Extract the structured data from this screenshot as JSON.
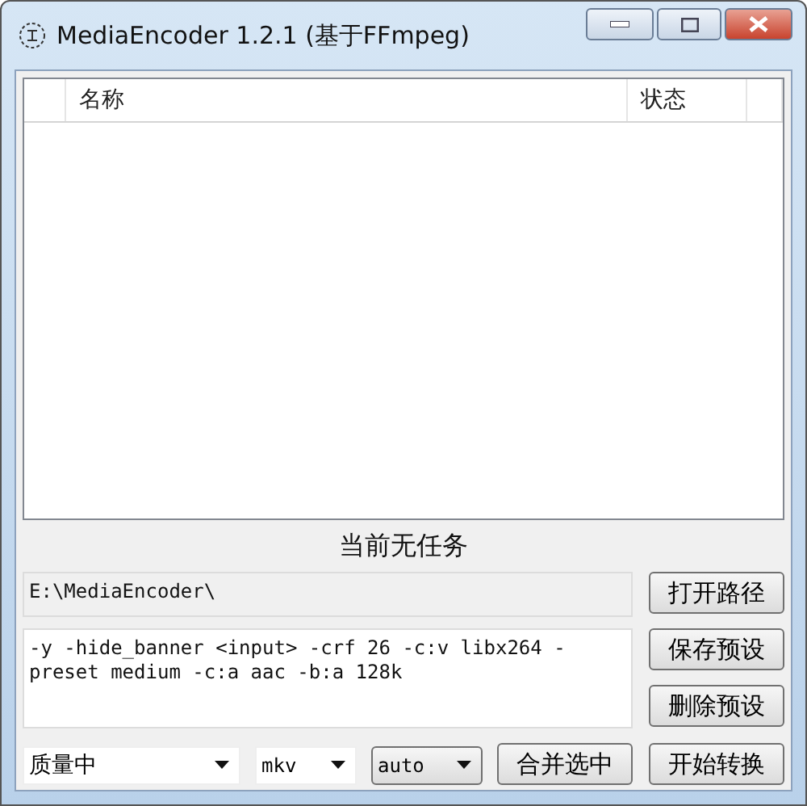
{
  "window": {
    "title": "MediaEncoder 1.2.1 (基于FFmpeg)"
  },
  "task_list": {
    "columns": [
      "名称",
      "状态"
    ]
  },
  "status": "当前无任务",
  "output_path": {
    "value": "E:\\MediaEncoder\\",
    "button": "打开路径"
  },
  "command": {
    "value": "-y -hide_banner <input> -crf 26 -c:v libx264 -preset medium -c:a aac -b:a 128k",
    "buttons": [
      "保存预设",
      "删除预设"
    ]
  },
  "bottom": [
    {
      "kind": "select",
      "value": "质量中"
    },
    {
      "kind": "select",
      "value": "mkv"
    },
    {
      "kind": "combo",
      "value": "auto"
    },
    {
      "kind": "button",
      "label": "合并选中"
    },
    {
      "kind": "button",
      "label": "开始转换"
    }
  ]
}
